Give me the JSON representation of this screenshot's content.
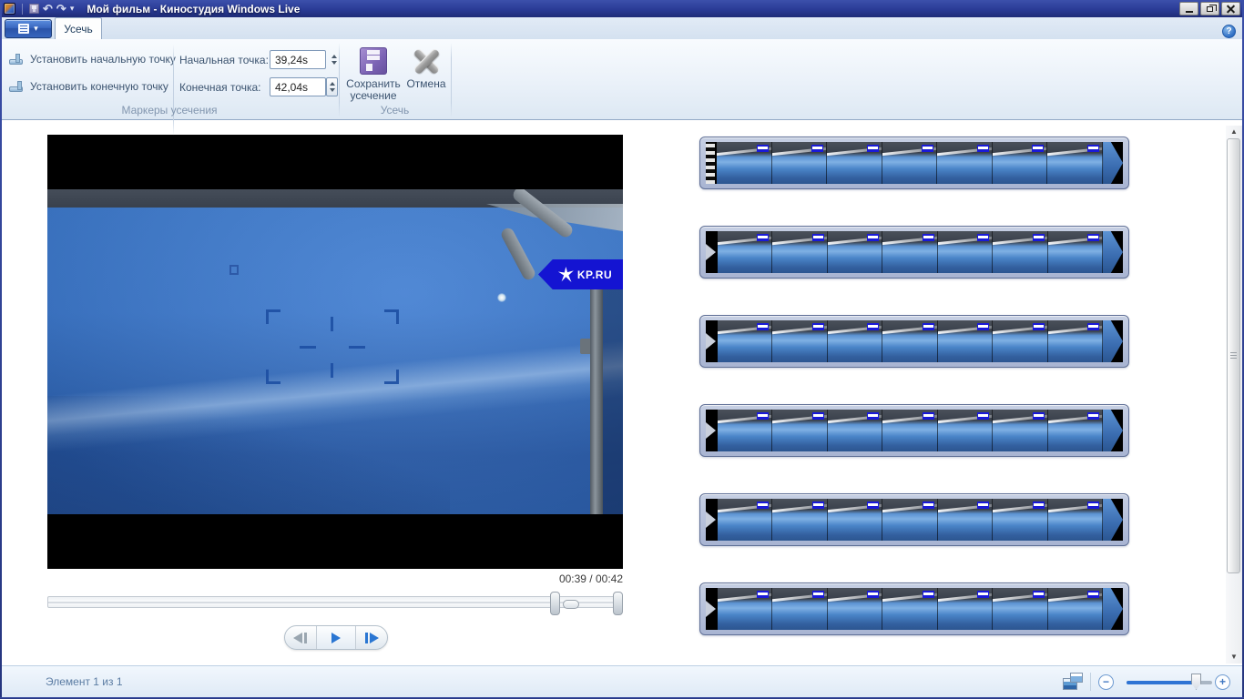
{
  "titlebar": {
    "title": "Мой фильм - Киностудия Windows Live"
  },
  "tabs": {
    "trim": "Усечь"
  },
  "ribbon": {
    "set_start": "Установить начальную точку",
    "set_end": "Установить конечную точку",
    "start_label": "Начальная точка:",
    "start_value": "39,24s",
    "end_label": "Конечная точка:",
    "end_value": "42,04s",
    "save_trim": "Сохранить усечение",
    "cancel": "Отмена",
    "group_markers": "Маркеры усечения",
    "group_trim": "Усечь"
  },
  "preview": {
    "logo_text": "KP.RU",
    "time": "00:39 / 00:42"
  },
  "filmstrips": {
    "rows": 6,
    "frames_per_row": 7
  },
  "statusbar": {
    "item_text": "Элемент 1 из 1"
  },
  "icons": {
    "help": "?",
    "undo": "↶",
    "redo": "↷",
    "dropdown": "▾",
    "scroll_up": "▲",
    "scroll_down": "▼",
    "minus": "−",
    "plus": "+"
  },
  "colors": {
    "titlebar_blue": "#2a3b96",
    "accent_blue": "#2f74d4",
    "logo_blue": "#1414d2"
  }
}
